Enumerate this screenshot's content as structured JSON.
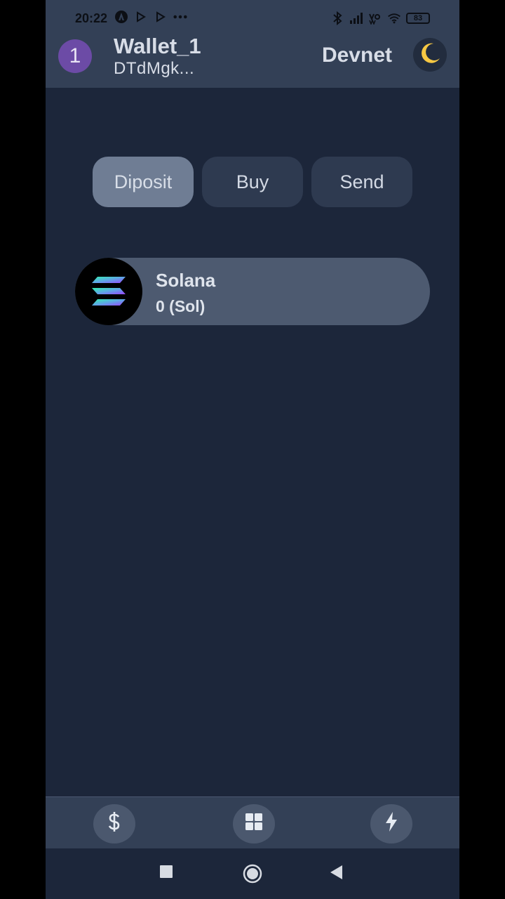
{
  "status_bar": {
    "time": "20:22",
    "battery": "83",
    "icons_left": [
      "app-notification-icon",
      "play-icon",
      "play-icon",
      "more-icon"
    ],
    "icons_right": [
      "bluetooth-icon",
      "signal-icon",
      "vowifi-icon",
      "wifi-icon",
      "battery-icon"
    ]
  },
  "header": {
    "avatar_label": "1",
    "wallet_name": "Wallet_1",
    "wallet_address": "DTdMgk...",
    "network": "Devnet",
    "theme_icon": "moon-icon"
  },
  "actions": [
    {
      "label": "Diposit",
      "active": true
    },
    {
      "label": "Buy",
      "active": false
    },
    {
      "label": "Send",
      "active": false
    }
  ],
  "tokens": [
    {
      "name": "Solana",
      "balance": "0 (Sol)",
      "icon": "solana-icon"
    }
  ],
  "bottom_nav": [
    {
      "icon": "dollar-icon"
    },
    {
      "icon": "grid-icon"
    },
    {
      "icon": "lightning-icon"
    }
  ],
  "system_nav": [
    "recents-icon",
    "home-icon",
    "back-icon"
  ],
  "colors": {
    "background": "#1c263a",
    "header": "#334056",
    "button": "#2e3a50",
    "button_active": "#6f7d94",
    "card": "#4d5a70",
    "avatar": "#6c4ba6"
  }
}
